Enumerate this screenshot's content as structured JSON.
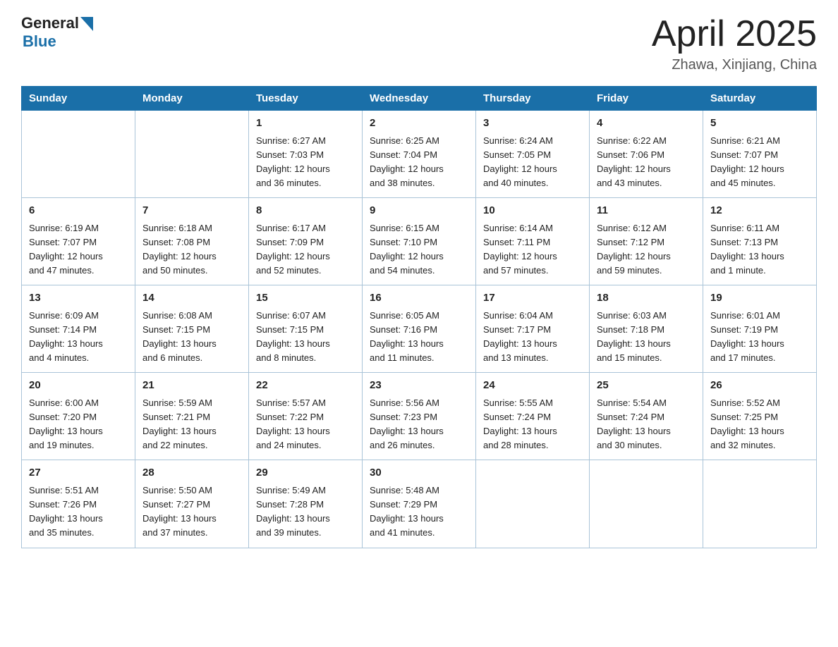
{
  "header": {
    "logo_general": "General",
    "logo_blue": "Blue",
    "logo_tagline": "Blue",
    "month_title": "April 2025",
    "location": "Zhawa, Xinjiang, China"
  },
  "weekdays": [
    "Sunday",
    "Monday",
    "Tuesday",
    "Wednesday",
    "Thursday",
    "Friday",
    "Saturday"
  ],
  "weeks": [
    [
      {
        "day": "",
        "info": ""
      },
      {
        "day": "",
        "info": ""
      },
      {
        "day": "1",
        "info": "Sunrise: 6:27 AM\nSunset: 7:03 PM\nDaylight: 12 hours\nand 36 minutes."
      },
      {
        "day": "2",
        "info": "Sunrise: 6:25 AM\nSunset: 7:04 PM\nDaylight: 12 hours\nand 38 minutes."
      },
      {
        "day": "3",
        "info": "Sunrise: 6:24 AM\nSunset: 7:05 PM\nDaylight: 12 hours\nand 40 minutes."
      },
      {
        "day": "4",
        "info": "Sunrise: 6:22 AM\nSunset: 7:06 PM\nDaylight: 12 hours\nand 43 minutes."
      },
      {
        "day": "5",
        "info": "Sunrise: 6:21 AM\nSunset: 7:07 PM\nDaylight: 12 hours\nand 45 minutes."
      }
    ],
    [
      {
        "day": "6",
        "info": "Sunrise: 6:19 AM\nSunset: 7:07 PM\nDaylight: 12 hours\nand 47 minutes."
      },
      {
        "day": "7",
        "info": "Sunrise: 6:18 AM\nSunset: 7:08 PM\nDaylight: 12 hours\nand 50 minutes."
      },
      {
        "day": "8",
        "info": "Sunrise: 6:17 AM\nSunset: 7:09 PM\nDaylight: 12 hours\nand 52 minutes."
      },
      {
        "day": "9",
        "info": "Sunrise: 6:15 AM\nSunset: 7:10 PM\nDaylight: 12 hours\nand 54 minutes."
      },
      {
        "day": "10",
        "info": "Sunrise: 6:14 AM\nSunset: 7:11 PM\nDaylight: 12 hours\nand 57 minutes."
      },
      {
        "day": "11",
        "info": "Sunrise: 6:12 AM\nSunset: 7:12 PM\nDaylight: 12 hours\nand 59 minutes."
      },
      {
        "day": "12",
        "info": "Sunrise: 6:11 AM\nSunset: 7:13 PM\nDaylight: 13 hours\nand 1 minute."
      }
    ],
    [
      {
        "day": "13",
        "info": "Sunrise: 6:09 AM\nSunset: 7:14 PM\nDaylight: 13 hours\nand 4 minutes."
      },
      {
        "day": "14",
        "info": "Sunrise: 6:08 AM\nSunset: 7:15 PM\nDaylight: 13 hours\nand 6 minutes."
      },
      {
        "day": "15",
        "info": "Sunrise: 6:07 AM\nSunset: 7:15 PM\nDaylight: 13 hours\nand 8 minutes."
      },
      {
        "day": "16",
        "info": "Sunrise: 6:05 AM\nSunset: 7:16 PM\nDaylight: 13 hours\nand 11 minutes."
      },
      {
        "day": "17",
        "info": "Sunrise: 6:04 AM\nSunset: 7:17 PM\nDaylight: 13 hours\nand 13 minutes."
      },
      {
        "day": "18",
        "info": "Sunrise: 6:03 AM\nSunset: 7:18 PM\nDaylight: 13 hours\nand 15 minutes."
      },
      {
        "day": "19",
        "info": "Sunrise: 6:01 AM\nSunset: 7:19 PM\nDaylight: 13 hours\nand 17 minutes."
      }
    ],
    [
      {
        "day": "20",
        "info": "Sunrise: 6:00 AM\nSunset: 7:20 PM\nDaylight: 13 hours\nand 19 minutes."
      },
      {
        "day": "21",
        "info": "Sunrise: 5:59 AM\nSunset: 7:21 PM\nDaylight: 13 hours\nand 22 minutes."
      },
      {
        "day": "22",
        "info": "Sunrise: 5:57 AM\nSunset: 7:22 PM\nDaylight: 13 hours\nand 24 minutes."
      },
      {
        "day": "23",
        "info": "Sunrise: 5:56 AM\nSunset: 7:23 PM\nDaylight: 13 hours\nand 26 minutes."
      },
      {
        "day": "24",
        "info": "Sunrise: 5:55 AM\nSunset: 7:24 PM\nDaylight: 13 hours\nand 28 minutes."
      },
      {
        "day": "25",
        "info": "Sunrise: 5:54 AM\nSunset: 7:24 PM\nDaylight: 13 hours\nand 30 minutes."
      },
      {
        "day": "26",
        "info": "Sunrise: 5:52 AM\nSunset: 7:25 PM\nDaylight: 13 hours\nand 32 minutes."
      }
    ],
    [
      {
        "day": "27",
        "info": "Sunrise: 5:51 AM\nSunset: 7:26 PM\nDaylight: 13 hours\nand 35 minutes."
      },
      {
        "day": "28",
        "info": "Sunrise: 5:50 AM\nSunset: 7:27 PM\nDaylight: 13 hours\nand 37 minutes."
      },
      {
        "day": "29",
        "info": "Sunrise: 5:49 AM\nSunset: 7:28 PM\nDaylight: 13 hours\nand 39 minutes."
      },
      {
        "day": "30",
        "info": "Sunrise: 5:48 AM\nSunset: 7:29 PM\nDaylight: 13 hours\nand 41 minutes."
      },
      {
        "day": "",
        "info": ""
      },
      {
        "day": "",
        "info": ""
      },
      {
        "day": "",
        "info": ""
      }
    ]
  ]
}
